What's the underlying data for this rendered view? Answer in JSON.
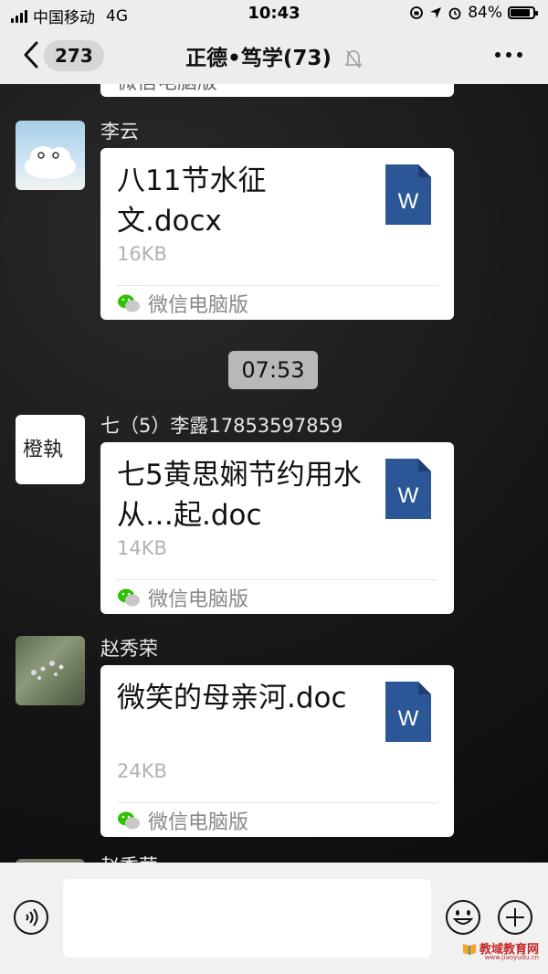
{
  "status_bar": {
    "carrier": "中国移动",
    "network": "4G",
    "time": "10:43",
    "battery": "84%"
  },
  "header": {
    "back_count": "273",
    "title": "正德•笃学(73)"
  },
  "top_partial_source": "微信电脑版",
  "messages": [
    {
      "sender": "李云",
      "file_name": "八11节水征文.docx",
      "file_size": "16KB",
      "source": "微信电脑版",
      "file_icon_letter": "W"
    },
    {
      "sender": "七（5）李露17853597859",
      "avatar_text": "橙執",
      "file_name": "七5黄思娴节约用水从…起.doc",
      "file_size": "14KB",
      "source": "微信电脑版",
      "file_icon_letter": "W"
    },
    {
      "sender": "赵秀荣",
      "file_name": "微笑的母亲河.doc",
      "file_size": "24KB",
      "source": "微信电脑版",
      "file_icon_letter": "W"
    }
  ],
  "timestamp": "07:53",
  "partial_sender": "赵秀荣",
  "watermark": {
    "text": "教域教育网",
    "sub": "www.jiaoyudu.cn"
  },
  "colors": {
    "word_blue": "#2b5797",
    "wechat_green": "#2dc100",
    "chat_bg": "#161616",
    "bar_bg": "#ededed"
  }
}
